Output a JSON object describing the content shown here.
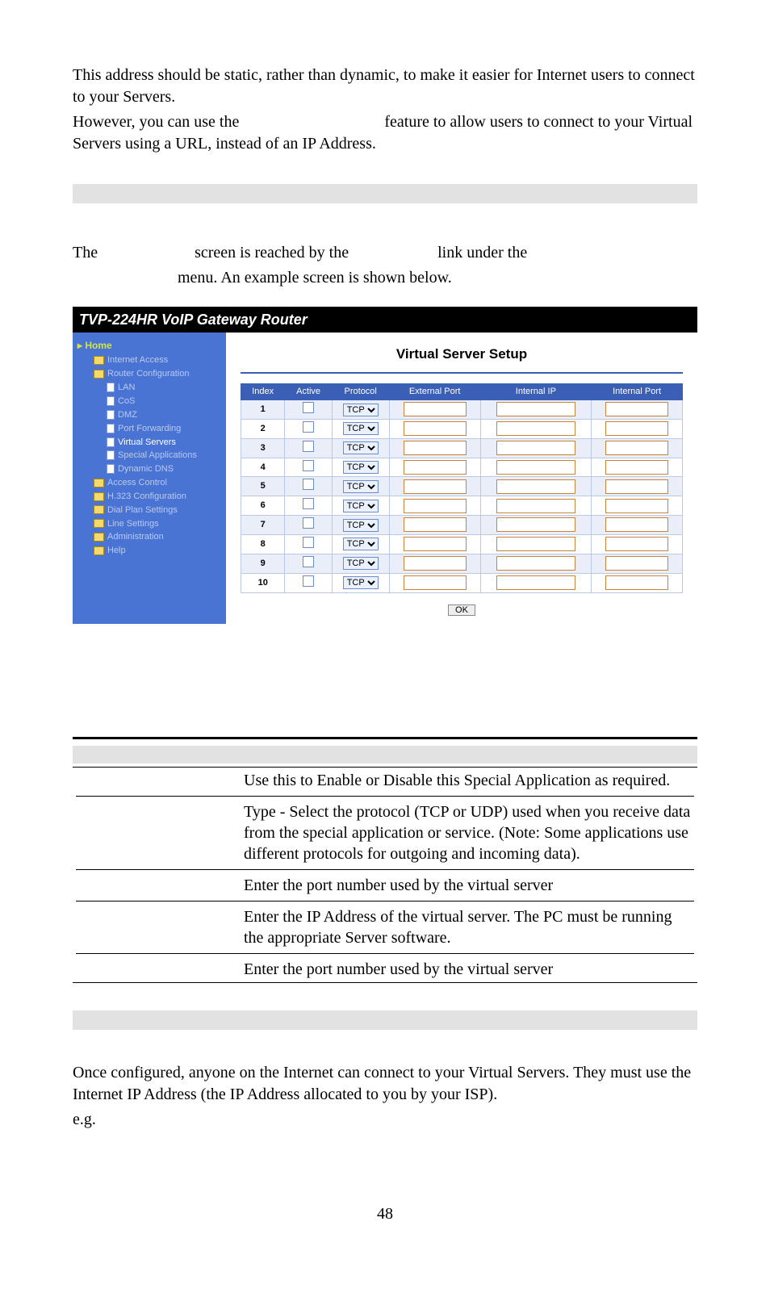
{
  "intro": {
    "p1": "This address should be static, rather than dynamic, to make it easier for Internet users to connect to your Servers.",
    "p2a": "However, you can use the",
    "p2b": "feature to allow users to connect to your Virtual Servers using a URL, instead of an IP Address."
  },
  "lead": {
    "a": "The",
    "b": "screen is reached by the",
    "c": "link under the",
    "d": "menu. An example screen is shown below."
  },
  "router": {
    "title": "TVP-224HR VoIP Gateway Router",
    "content_title": "Virtual Server Setup",
    "nav": {
      "home": "Home",
      "items": [
        "Internet Access",
        "Router Configuration",
        "LAN",
        "CoS",
        "DMZ",
        "Port Forwarding",
        "Virtual Servers",
        "Special Applications",
        "Dynamic DNS",
        "Access Control",
        "H.323 Configuration",
        "Dial Plan Settings",
        "Line Settings",
        "Administration",
        "Help"
      ]
    },
    "headers": [
      "Index",
      "Active",
      "Protocol",
      "External Port",
      "Internal IP",
      "Internal Port"
    ],
    "rows": [
      1,
      2,
      3,
      4,
      5,
      6,
      7,
      8,
      9,
      10
    ],
    "proto_default": "TCP",
    "ok": "OK"
  },
  "spec": {
    "r1": "Use this to Enable or Disable this Special Application as required.",
    "r2": "Type - Select the protocol (TCP or UDP) used when you receive data from the special application or service. (Note: Some applications use different protocols for outgoing and incoming data).",
    "r3": "Enter the port number used by the virtual server",
    "r4": "Enter the IP Address of the virtual server.  The PC must be running the appropriate Server software.",
    "r5": "Enter the port number used by the virtual server"
  },
  "tail": {
    "p1": "Once configured, anyone on the Internet can connect to your Virtual Servers. They must use the Internet IP Address (the IP Address allocated to you by your ISP).",
    "p2": "e.g."
  },
  "page_number": "48"
}
